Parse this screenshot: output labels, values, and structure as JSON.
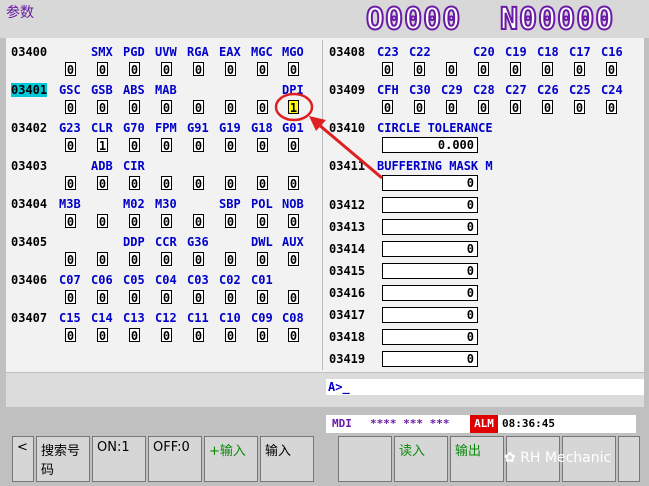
{
  "title": "参数",
  "program": {
    "o": "O0000",
    "n": "N00000"
  },
  "params_left": [
    {
      "no": "03400",
      "bits": [
        "",
        "SMX",
        "PGD",
        "UVW",
        "RGA",
        "EAX",
        "MGC",
        "MGO"
      ],
      "vals": [
        "0",
        "0",
        "0",
        "0",
        "0",
        "0",
        "0",
        "0"
      ]
    },
    {
      "no": "03401",
      "bits": [
        "GSC",
        "GSB",
        "ABS",
        "MAB",
        "",
        "",
        "",
        "DPI"
      ],
      "vals": [
        "0",
        "0",
        "0",
        "0",
        "0",
        "0",
        "0",
        "1"
      ]
    },
    {
      "no": "03402",
      "bits": [
        "G23",
        "CLR",
        "G70",
        "FPM",
        "G91",
        "G19",
        "G18",
        "G01"
      ],
      "vals": [
        "0",
        "1",
        "0",
        "0",
        "0",
        "0",
        "0",
        "0"
      ]
    },
    {
      "no": "03403",
      "bits": [
        "",
        "ADB",
        "CIR",
        "",
        "",
        "",
        "",
        ""
      ],
      "vals": [
        "0",
        "0",
        "0",
        "0",
        "0",
        "0",
        "0",
        "0"
      ]
    },
    {
      "no": "03404",
      "bits": [
        "M3B",
        "",
        "M02",
        "M30",
        "",
        "SBP",
        "POL",
        "NOB"
      ],
      "vals": [
        "0",
        "0",
        "0",
        "0",
        "0",
        "0",
        "0",
        "0"
      ]
    },
    {
      "no": "03405",
      "bits": [
        "",
        "",
        "DDP",
        "CCR",
        "G36",
        "",
        "DWL",
        "AUX"
      ],
      "vals": [
        "0",
        "0",
        "0",
        "0",
        "0",
        "0",
        "0",
        "0"
      ]
    },
    {
      "no": "03406",
      "bits": [
        "C07",
        "C06",
        "C05",
        "C04",
        "C03",
        "C02",
        "C01",
        ""
      ],
      "vals": [
        "0",
        "0",
        "0",
        "0",
        "0",
        "0",
        "0",
        "0"
      ]
    },
    {
      "no": "03407",
      "bits": [
        "C15",
        "C14",
        "C13",
        "C12",
        "C11",
        "C10",
        "C09",
        "C08"
      ],
      "vals": [
        "0",
        "0",
        "0",
        "0",
        "0",
        "0",
        "0",
        "0"
      ]
    }
  ],
  "params_right_bits": [
    {
      "no": "03408",
      "bits": [
        "C23",
        "C22",
        "",
        "",
        "C20",
        "C19",
        "C18",
        "C17",
        "C16"
      ],
      "vals": [
        "0",
        "0",
        "0",
        "0",
        "0",
        "0",
        "0",
        "0"
      ]
    },
    {
      "no": "03409",
      "bits": [
        "CFH",
        "C30",
        "C29",
        "C28",
        "C27",
        "C26",
        "C25",
        "C24"
      ],
      "vals": [
        "0",
        "0",
        "0",
        "0",
        "0",
        "0",
        "0",
        "0"
      ]
    }
  ],
  "p3410": {
    "no": "03410",
    "name": "CIRCLE TOLERANCE",
    "value": "0.000"
  },
  "p3411": {
    "no": "03411",
    "name": "BUFFERING MASK M",
    "value": "0"
  },
  "word_params": [
    {
      "no": "03412",
      "value": "0"
    },
    {
      "no": "03413",
      "value": "0"
    },
    {
      "no": "03414",
      "value": "0"
    },
    {
      "no": "03415",
      "value": "0"
    },
    {
      "no": "03416",
      "value": "0"
    },
    {
      "no": "03417",
      "value": "0"
    },
    {
      "no": "03418",
      "value": "0"
    },
    {
      "no": "03419",
      "value": "0"
    }
  ],
  "input_prompt": "A>_",
  "status": {
    "mode": "MDI",
    "stars": "**** *** ***",
    "alarm": "ALM",
    "time": "08:36:45"
  },
  "softkeys": [
    "<",
    "搜索号码",
    "ON:1",
    "OFF:0",
    "+输入",
    "输入",
    "",
    "读入",
    "输出",
    "",
    "",
    ""
  ],
  "watermark": "RH Mechanic",
  "colors": {
    "accent": "#6a1aa6",
    "label_blue": "#0000c8",
    "highlight": "#00c8d8",
    "selected": "#ffff00",
    "alarm": "#e00000"
  }
}
